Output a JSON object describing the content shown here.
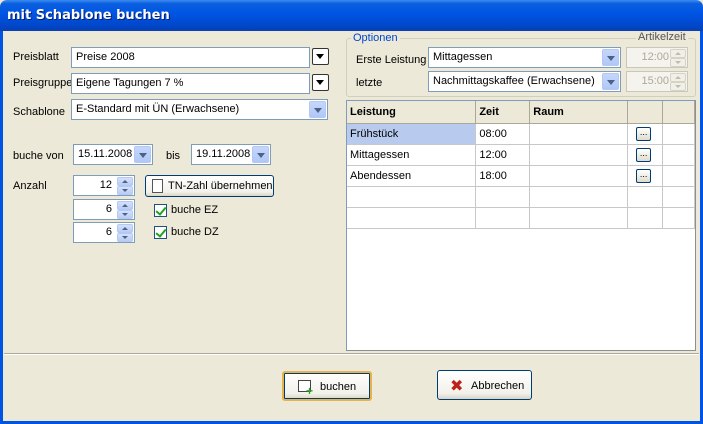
{
  "window": {
    "title": "mit Schablone buchen"
  },
  "left": {
    "preisblatt": {
      "label": "Preisblatt",
      "value": "Preise 2008"
    },
    "preisgruppe": {
      "label": "Preisgruppe",
      "value": "Eigene Tagungen 7 %"
    },
    "schablone": {
      "label": "Schablone",
      "value": "E-Standard mit ÜN (Erwachsene)"
    },
    "buche_von": {
      "label": "buche von",
      "value": "15.11.2008"
    },
    "bis": {
      "label": "bis",
      "value": "19.11.2008"
    },
    "anzahl": {
      "label": "Anzahl",
      "value": "12",
      "ez_value": "6",
      "dz_value": "6"
    },
    "tn_button": "TN-Zahl übernehmen",
    "buche_ez": "buche EZ",
    "buche_dz": "buche DZ"
  },
  "optionen": {
    "title": "Optionen",
    "artikelzeit": "Artikelzeit",
    "erste": {
      "label": "Erste Leistung",
      "value": "Mittagessen",
      "time": "12:00"
    },
    "letzte": {
      "label": "letzte",
      "value": "Nachmittagskaffee (Erwachsene)",
      "time": "15:00"
    }
  },
  "grid": {
    "columns": [
      "Leistung",
      "Zeit",
      "Raum",
      "",
      ""
    ],
    "rows": [
      {
        "leistung": "Frühstück",
        "zeit": "08:00",
        "raum": "",
        "btn": "..."
      },
      {
        "leistung": "Mittagessen",
        "zeit": "12:00",
        "raum": "",
        "btn": "..."
      },
      {
        "leistung": "Abendessen",
        "zeit": "18:00",
        "raum": "",
        "btn": "..."
      },
      {
        "leistung": "",
        "zeit": "",
        "raum": "",
        "btn": ""
      },
      {
        "leistung": "",
        "zeit": "",
        "raum": "",
        "btn": ""
      }
    ]
  },
  "buttons": {
    "buchen": "buchen",
    "abbrechen": "Abbrechen"
  },
  "colors": {
    "titlebar": "#0054e3",
    "dialog_bg": "#ece9d8",
    "selection": "#b8cbef",
    "group_title": "#0046d5"
  }
}
